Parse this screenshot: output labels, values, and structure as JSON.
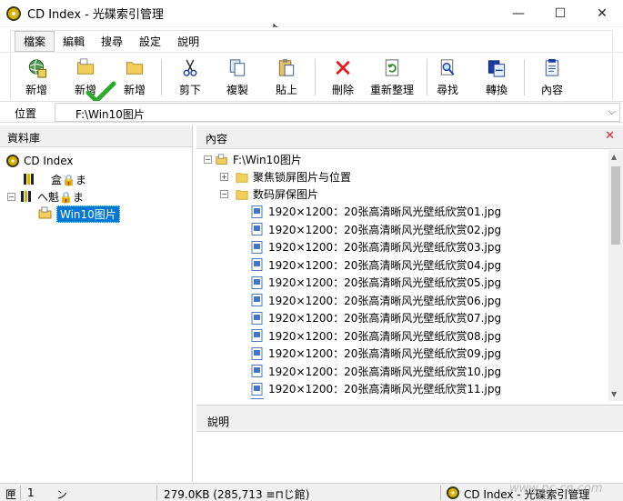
{
  "window": {
    "title": "CD Index - 光碟索引管理",
    "minimize": "—",
    "maximize": "☐",
    "close": "✕"
  },
  "menu": [
    "檔案",
    "編輯",
    "搜尋",
    "設定",
    "說明"
  ],
  "toolbar": [
    {
      "label": "新增",
      "icon": "globe-plus-icon"
    },
    {
      "label": "新增",
      "icon": "folder-plus-icon"
    },
    {
      "label": "新增",
      "icon": "folder-icon"
    },
    {
      "label": "剪下",
      "icon": "scissors-icon"
    },
    {
      "label": "複製",
      "icon": "copy-icon"
    },
    {
      "label": "貼上",
      "icon": "paste-icon"
    },
    {
      "label": "刪除",
      "icon": "delete-x-icon"
    },
    {
      "label": "重新整理",
      "icon": "refresh-icon"
    },
    {
      "label": "尋找",
      "icon": "find-icon"
    },
    {
      "label": "轉換",
      "icon": "convert-icon"
    },
    {
      "label": "內容",
      "icon": "properties-icon"
    }
  ],
  "address": {
    "label": "位置",
    "value": "F:\\Win10图片"
  },
  "left_pane": {
    "title": "資料庫",
    "tree": {
      "root": "CD Index",
      "items": [
        {
          "label": "盒🔒ま",
          "expander": ""
        },
        {
          "label": "へ魁🔒ま",
          "expander": "⊟"
        }
      ],
      "selected": "Win10图片"
    }
  },
  "right_pane": {
    "title": "內容",
    "close_icon": "✕",
    "root": "F:\\Win10图片",
    "folders": [
      {
        "label": "聚焦锁屏图片与位置",
        "expander": "⊞"
      },
      {
        "label": "数码屏保图片",
        "expander": "⊟"
      }
    ],
    "files": [
      "1920×1200：20张高清晰风光壁纸欣赏01.jpg",
      "1920×1200：20张高清晰风光壁纸欣赏02.jpg",
      "1920×1200：20张高清晰风光壁纸欣赏03.jpg",
      "1920×1200：20张高清晰风光壁纸欣赏04.jpg",
      "1920×1200：20张高清晰风光壁纸欣赏05.jpg",
      "1920×1200：20张高清晰风光壁纸欣赏06.jpg",
      "1920×1200：20张高清晰风光壁纸欣赏07.jpg",
      "1920×1200：20张高清晰风光壁纸欣赏08.jpg",
      "1920×1200：20张高清晰风光壁纸欣赏09.jpg",
      "1920×1200：20张高清晰风光壁纸欣赏10.jpg",
      "1920×1200：20张高清晰风光壁纸欣赏11.jpg"
    ]
  },
  "description_pane": {
    "title": "說明"
  },
  "statusbar": {
    "s1": "匣",
    "s2": "1",
    "s3": "ン",
    "size": "279.0KB (285,713 ≡⊓じ館)",
    "app": "CD Index - 光碟索引管理"
  },
  "watermark": "www.pc-cn.com"
}
